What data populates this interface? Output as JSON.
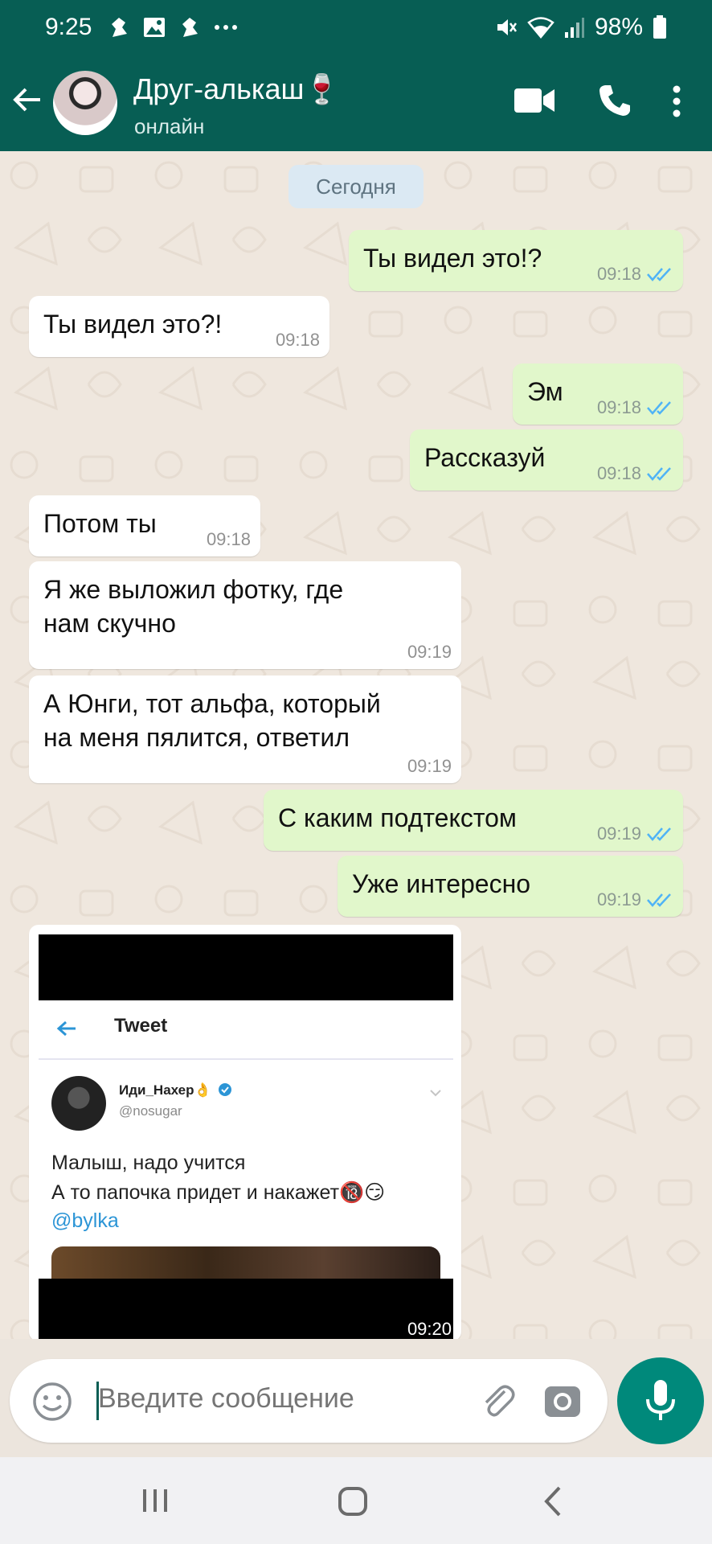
{
  "status_bar": {
    "time": "9:25",
    "battery": "98%"
  },
  "header": {
    "title": "Друг-алькаш🍷",
    "status": "онлайн"
  },
  "date_chip": "Сегодня",
  "messages": [
    {
      "dir": "out",
      "text": "Ты видел это!?",
      "time": "09:18",
      "read": true
    },
    {
      "dir": "in",
      "text": "Ты видел это?!",
      "time": "09:18"
    },
    {
      "dir": "out",
      "text": "Эм",
      "time": "09:18",
      "read": true
    },
    {
      "dir": "out",
      "text": "Рассказуй",
      "time": "09:18",
      "read": true
    },
    {
      "dir": "in",
      "text": "Потом ты",
      "time": "09:18"
    },
    {
      "dir": "in",
      "lines": [
        "Я же выложил фотку, где",
        "нам скучно"
      ],
      "time": "09:19"
    },
    {
      "dir": "in",
      "lines": [
        "А Юнги, тот альфа, который",
        "на меня пялится, ответил"
      ],
      "time": "09:19"
    },
    {
      "dir": "out",
      "text": "С каким подтекстом",
      "time": "09:19",
      "read": true
    },
    {
      "dir": "out",
      "text": "Уже интересно",
      "time": "09:19",
      "read": true
    }
  ],
  "image_message": {
    "time": "09:20",
    "tweet": {
      "title": "Tweet",
      "author_name": "Иди_Нахер👌",
      "author_handle": "@nosugar",
      "line1": "Малыш, надо учится",
      "line2": "А то папочка придет и накажет🔞😏",
      "mention": "@bylka"
    }
  },
  "composer": {
    "placeholder": "Введите сообщение"
  },
  "colors": {
    "header": "#075e54",
    "outgoing_bubble": "#e1f7cb",
    "incoming_bubble": "#ffffff",
    "read_ticks": "#4fb3f6",
    "mic_button": "#00897b"
  },
  "icons": [
    "back-arrow-icon",
    "video-call-icon",
    "phone-icon",
    "more-vert-icon",
    "emoji-icon",
    "attach-icon",
    "camera-icon",
    "mic-icon",
    "recents-icon",
    "home-icon",
    "nav-back-icon"
  ]
}
